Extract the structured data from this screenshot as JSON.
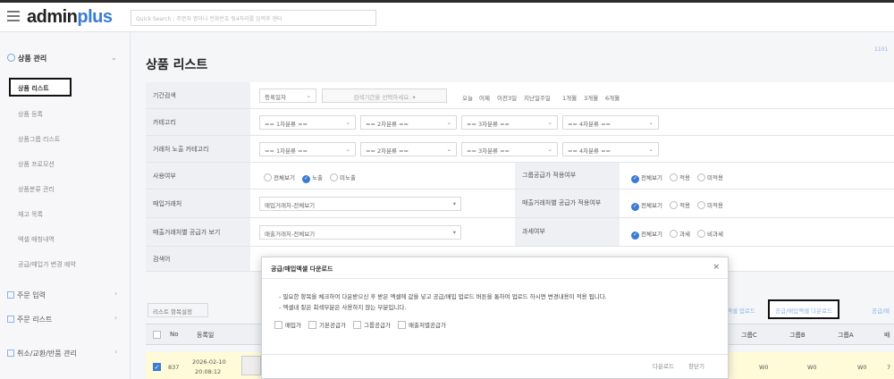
{
  "header": {
    "logo_main": "admin",
    "logo_accent": "plus",
    "quick_search_placeholder": "Quick Search : 주문자 명이나 전화번호 뒷4자리를 입력후 엔터"
  },
  "sidebar": {
    "section_title": "상품 관리",
    "items": [
      "상품 리스트",
      "상품 등록",
      "상품그룹 리스트",
      "상품 프로모션",
      "상품분류 관리",
      "재고 목록",
      "엑셀 매칭내역",
      "공급/매입가 변경 예약"
    ],
    "sections": [
      "주문 입력",
      "주문 리스트",
      "취소/교환/반품 관리"
    ]
  },
  "main": {
    "page_title": "상품 리스트",
    "top_right": "1101"
  },
  "filter": {
    "period": {
      "label": "기간검색",
      "select": "등록일자",
      "date_placeholder": "검색기간을 선택하세요.",
      "quick": [
        "오늘",
        "어제",
        "이전3일",
        "지난일주일",
        "1개월",
        "3개월",
        "6개월"
      ]
    },
    "category": {
      "label": "카테고리",
      "selects": [
        "== 1차분류 ==",
        "== 2차분류 ==",
        "== 3차분류 ==",
        "== 4차분류 =="
      ]
    },
    "vendor_category": {
      "label": "거래처 노출 카테고리",
      "selects": [
        "== 1차분류 ==",
        "== 2차분류 ==",
        "== 3차분류 ==",
        "== 4차분류 =="
      ]
    },
    "usage": {
      "label": "사용여부",
      "options": [
        "전체보기",
        "노출",
        "미노출"
      ],
      "group_label": "그룹공급가 적용여부",
      "group_options": [
        "전체보기",
        "적용",
        "미적용"
      ]
    },
    "purchase_vendor": {
      "label": "매입거래처",
      "select": "매입거래처-전체보기",
      "sales_label": "매출거래처별 공급가 적용여부",
      "sales_options": [
        "전체보기",
        "적용",
        "미적용"
      ]
    },
    "sales_vendor": {
      "label": "매출거래처별 공급가 보기",
      "select": "매출거래처-전체보기",
      "tax_label": "과세여부",
      "tax_options": [
        "전체보기",
        "과세",
        "비과세"
      ]
    },
    "keyword": {
      "label": "검색어"
    }
  },
  "list": {
    "setting_button": "리스트 항목설정",
    "right_buttons": [
      "엑셀 업로드",
      "공급/매입엑셀 다운로드",
      "공급/매"
    ],
    "columns": [
      "No",
      "등록일",
      "그룹C",
      "그룹B",
      "그룹A",
      "배"
    ],
    "rows": [
      {
        "no": "837",
        "date": "2026-02-10",
        "time": "20:08:12",
        "c": "W0",
        "b": "W0",
        "a": "W0",
        "x": "7"
      }
    ]
  },
  "modal": {
    "title": "공급/매입엑셀 다운로드",
    "close": "×",
    "note1": "- 필요한 항목을 체크하여 다운받으신 후 받은 엑셀에 값을 넣고 공급/매입 업로드 버튼을 통하여 업로드 하시면 변경내용이 적용 됩니다.",
    "note2": "- 엑셀내 짙은 회색부분은 사용하지 않는 부분입니다.",
    "options": [
      "매입가",
      "기본공급가",
      "그룹공급가",
      "매출처별공급가"
    ],
    "download": "다운로드",
    "close_button": "창닫기"
  }
}
